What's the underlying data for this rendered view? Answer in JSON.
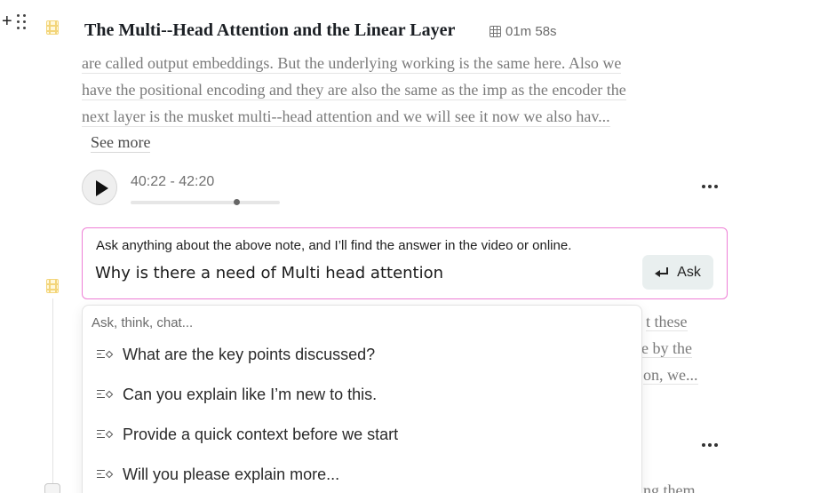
{
  "gutter": {
    "add_symbol": "+"
  },
  "section": {
    "title": "The Multi--Head Attention and the Linear Layer",
    "duration": "01m 58s",
    "lines": [
      "are called output embeddings. But the underlying working is the same here. Also we",
      "have the positional encoding and they are also the same as the imp as the encoder the",
      "next layer is the musket multi--head attention and we will see it now we also hav..."
    ],
    "see_more": "See more"
  },
  "player": {
    "time_range": "40:22 - 42:20",
    "progress": 0.71
  },
  "ask": {
    "hint": "Ask anything about the above note, and I’ll find the answer in the video or online.",
    "input_value": "Why is there a need of Multi head attention",
    "button_label": "Ask"
  },
  "background_snippets": [
    "t these",
    "e by the",
    "on, we...",
    "ng them"
  ],
  "dropdown": {
    "heading": "Ask, think, chat...",
    "items": [
      "What are the key points discussed?",
      "Can you explain like I’m new to this.",
      "Provide a quick context before we start",
      "Will you please explain more..."
    ]
  },
  "colors": {
    "accent_border": "#ee7fd6",
    "film_icon": "#f3d57a",
    "ask_button_bg": "#e9efef"
  }
}
